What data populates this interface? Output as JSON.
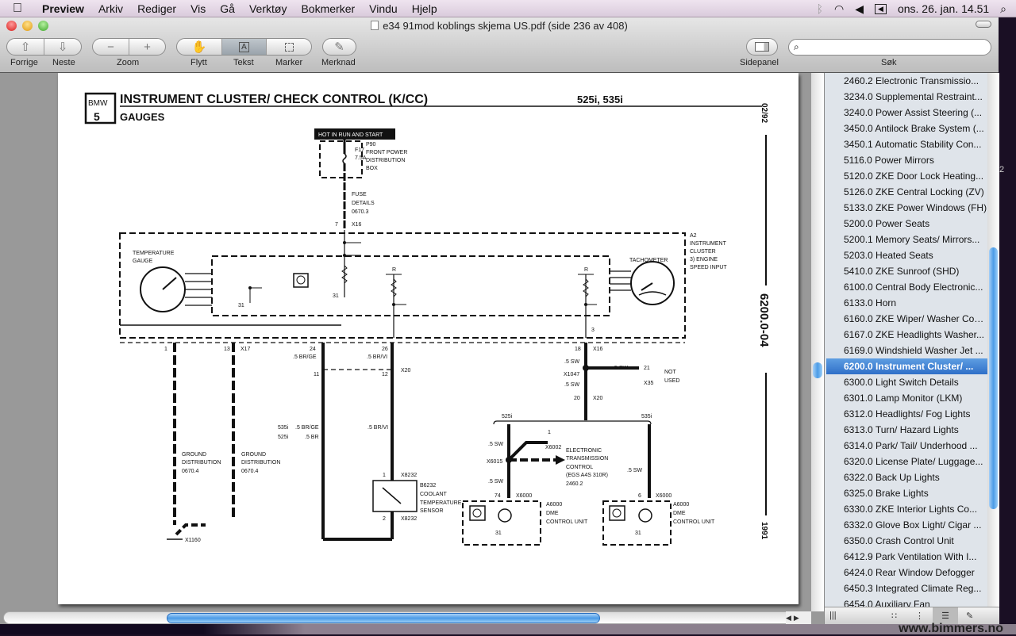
{
  "menubar": {
    "app": "Preview",
    "items": [
      "Arkiv",
      "Rediger",
      "Vis",
      "Gå",
      "Verktøy",
      "Bokmerker",
      "Vindu",
      "Hjelp"
    ],
    "clock": "ons. 26. jan.  14.51",
    "icons": [
      "apple-icon",
      "bluetooth-icon",
      "wifi-icon",
      "volume-icon",
      "battery-icon",
      "spotlight-icon"
    ]
  },
  "window": {
    "title": "e34 91mod  koblings skjema US.pdf (side 236 av 408)"
  },
  "toolbar": {
    "prev": "Forrige",
    "next": "Neste",
    "zoom": "Zoom",
    "move": "Flytt",
    "text": "Tekst",
    "select": "Marker",
    "annotate": "Merknad",
    "sidebar": "Sidepanel",
    "search": "Søk",
    "search_value": "",
    "active_tool": "Tekst"
  },
  "sidebar": {
    "items": [
      "2460.2 Electronic Transmissio...",
      "3234.0 Supplemental Restraint...",
      "3240.0 Power Assist Steering (...",
      "3450.0 Antilock Brake System (...",
      "3450.1 Automatic Stability Con...",
      "5116.0 Power Mirrors",
      "5120.0 ZKE Door Lock Heating...",
      "5126.0 ZKE Central Locking (ZV)",
      "5133.0 ZKE Power Windows (FH)",
      "5200.0 Power Seats",
      "5200.1 Memory Seats/ Mirrors...",
      "5203.0 Heated Seats",
      "5410.0 ZKE Sunroof (SHD)",
      "6100.0 Central Body Electronic...",
      "6133.0 Horn",
      "6160.0 ZKE Wiper/ Washer Control",
      "6167.0 ZKE Headlights Washer...",
      "6169.0 Windshield Washer Jet ...",
      "6200.0 Instrument Cluster/ ...",
      "6300.0 Light Switch Details",
      "6301.0 Lamp Monitor (LKM)",
      "6312.0 Headlights/ Fog Lights",
      "6313.0 Turn/ Hazard Lights",
      "6314.0 Park/ Tail/ Underhood ...",
      "6320.0 License Plate/ Luggage...",
      "6322.0 Back Up Lights",
      "6325.0 Brake Lights",
      "6330.0  ZKE Interior Lights Co...",
      "6332.0 Glove Box Light/ Cigar ...",
      "6350.0 Crash Control Unit",
      "6412.9 Park Ventilation With I...",
      "6424.0 Rear Window Defogger",
      "6450.3 Integrated Climate Reg...",
      "6454.0 Auxiliary Fan"
    ],
    "selected_index": 18
  },
  "watermark": "www.bimmers.no",
  "desktop_fragment": "2",
  "doc": {
    "logo_bmw": "BMW",
    "logo_5": "5",
    "title": "INSTRUMENT CLUSTER/ CHECK CONTROL (K/CC)",
    "models": "525i, 535i",
    "subtitle": "GAUGES",
    "date": "02/92",
    "pagecode": "6200.0-04",
    "year": "1991",
    "hot": "HOT IN RUN AND START",
    "f17": "F17",
    "f17a": "7.5A",
    "p90": [
      "P90",
      "FRONT POWER",
      "DISTRIBUTION",
      "BOX"
    ],
    "fuse": [
      "FUSE",
      "DETAILS",
      "0670.3"
    ],
    "pin7": "7",
    "x16a": "X16",
    "a2": [
      "A2",
      "INSTRUMENT",
      "CLUSTER",
      "3)   ENGINE",
      "      SPEED INPUT"
    ],
    "tempgauge": [
      "TEMPERATURE",
      "GAUGE"
    ],
    "tach": "TACHOMETER",
    "r": "R",
    "g31": "31",
    "p3": "3",
    "p1": "1",
    "p13": "13",
    "x17": "X17",
    "p24": "24",
    "brge": ".5 BR/GE",
    "p26": "26",
    "brvi": ".5 BR/VI",
    "p18": "18",
    "x16b": "X16",
    "x20": "X20",
    "p11": "11",
    "p12": "12",
    "gnd": [
      "GROUND",
      "DISTRIBUTION",
      "0670.4"
    ],
    "w535": "535i",
    "w535c": ".5 BR/GE",
    "w525": "525i",
    "w525c": ".5 BR",
    "brvi2": ".5 BR/VI",
    "x1160": "X1160",
    "s1": "1",
    "x8232": "X8232",
    "s2": "2",
    "sensor": [
      "B6232",
      "COOLANT",
      "TEMPERATURE",
      "SENSOR"
    ],
    "sw": ".5 SW",
    "x1047": "X1047",
    "p21": "21",
    "notused": [
      "NOT",
      "USED"
    ],
    "x35": "X35",
    "p20": "20",
    "m525": "525i",
    "m535": "535i",
    "x6015": "X6015",
    "x6002": "X6002",
    "egs": [
      "ELECTRONIC",
      "TRANSMISSION",
      "CONTROL",
      "(EGS A4S 310R)",
      "2460.2"
    ],
    "p74": "74",
    "x6000": "X6000",
    "p6": "6",
    "dme": [
      "A6000",
      "DME",
      "CONTROL UNIT"
    ]
  }
}
